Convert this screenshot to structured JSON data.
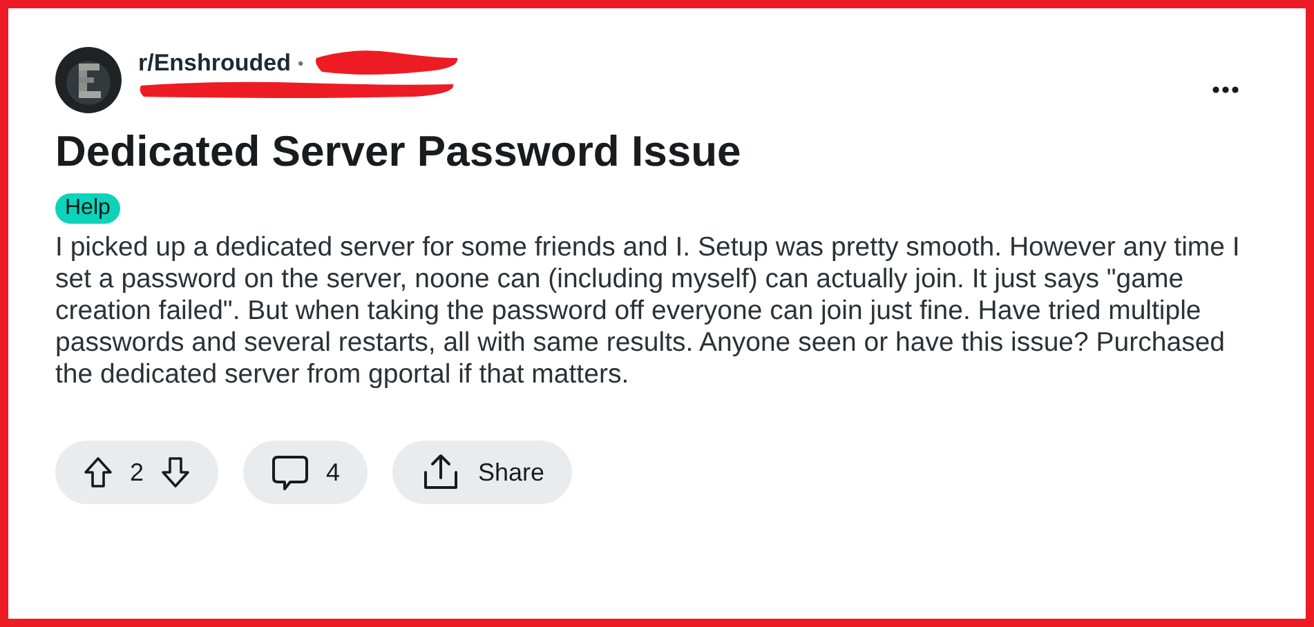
{
  "post": {
    "subreddit": "r/Enshrouded",
    "separator": "•",
    "title": "Dedicated Server Password Issue",
    "flair": "Help",
    "body": "I picked up a dedicated server for some friends and I. Setup was pretty smooth. However any time I set a password on the server, noone can (including myself) can actually join. It just says \"game creation failed\". But when taking the password off everyone can join just fine. Have tried multiple passwords and several restarts, all with same results. Anyone seen or have this issue? Purchased the dedicated server from gportal if that matters.",
    "votes": "2",
    "comments": "4",
    "share": "Share"
  }
}
